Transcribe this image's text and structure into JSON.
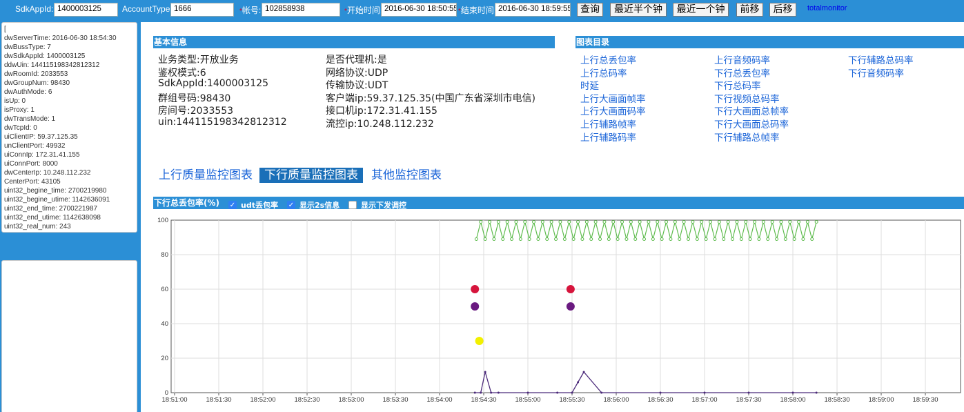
{
  "toolbar": {
    "sdkappid_label": "SdkAppId:",
    "sdkappid_value": "1400003125",
    "accounttype_label": "AccountType:",
    "accounttype_value": "1666",
    "account_label": "帐号:",
    "account_value": "102858938",
    "start_label": "开始时间:",
    "start_value": "2016-06-30 18:50:55",
    "end_label": "结束时间:",
    "end_value": "2016-06-30 18:59:55",
    "required_mark": "*",
    "query_btn": "查询",
    "half_btn": "最近半个钟",
    "one_btn": "最近一个钟",
    "prev_btn": "前移",
    "next_btn": "后移",
    "link": "totalmonitor"
  },
  "raw_lines": [
    "[",
    "dwServerTime: 2016-06-30 18:54:30",
    "dwBussType: 7",
    "dwSdkAppId: 1400003125",
    "ddwUin: 144115198342812312",
    "dwRoomId: 2033553",
    "dwGroupNum: 98430",
    "dwAuthMode: 6",
    "isUp: 0",
    "isProxy: 1",
    "dwTransMode: 1",
    "dwTcpId: 0",
    "uiClientIP: 59.37.125.35",
    "unClientPort: 49932",
    "uiConnIp: 172.31.41.155",
    "uiConnPort: 8000",
    "dwCenterIp: 10.248.112.232",
    "CenterPort: 43105",
    "uint32_begine_time: 2700219980",
    "uint32_begine_utime: 1142636091",
    "uint32_end_time: 2700221987",
    "uint32_end_utime: 1142638098",
    "uint32_real_num: 243"
  ],
  "basic_info": {
    "title": "基本信息",
    "col1": [
      "业务类型:开放业务",
      "鉴权模式:6",
      "SdkAppId:1400003125",
      "群组号码:98430",
      "房间号:2033553",
      "uin:144115198342812312"
    ],
    "col2": [
      "是否代理机:是",
      "网络协议:UDP",
      "传输协议:UDT",
      "客户端ip:59.37.125.35(中国广东省深圳市电信)",
      "接口机ip:172.31.41.155",
      "流控ip:10.248.112.232"
    ]
  },
  "catalog": {
    "title": "图表目录",
    "col1": [
      "上行总丢包率",
      "上行总码率",
      "时延",
      "上行大画面帧率",
      "上行大画面码率",
      "上行辅路帧率",
      "上行辅路码率"
    ],
    "col2": [
      "上行音频码率",
      "下行总丢包率",
      "下行总码率",
      "下行视频总码率",
      "下行大画面总帧率",
      "下行大画面总码率",
      "下行辅路总帧率"
    ],
    "col3": [
      "下行辅路总码率",
      "下行音频码率"
    ]
  },
  "tabs": [
    "上行质量监控图表",
    "下行质量监控图表",
    "其他监控图表"
  ],
  "chart_header": {
    "title": "下行总丢包率(%)",
    "opt1": "udt丢包率",
    "opt2": "显示2s信息",
    "opt3": "显示下发调控",
    "check": "✓"
  },
  "colors": {
    "header_blue": "#2b8fd6",
    "green_series": "#5dbb4c",
    "purple_series": "#4b2a7a",
    "red_marker": "#d6143c",
    "purple_marker": "#6a1a80",
    "yellow_marker": "#f2f000"
  },
  "chart_data": {
    "type": "line",
    "title": "下行总丢包率(%)",
    "ylim": [
      0,
      100
    ],
    "yticks": [
      0,
      20,
      40,
      60,
      80,
      100
    ],
    "x_start": "18:51:00",
    "x_end": "18:59:55",
    "xticks": [
      "18:51:00",
      "18:51:30",
      "18:52:00",
      "18:52:30",
      "18:53:00",
      "18:53:30",
      "18:54:00",
      "18:54:30",
      "18:55:00",
      "18:55:30",
      "18:56:00",
      "18:56:30",
      "18:57:00",
      "18:57:30",
      "18:58:00",
      "18:58:30",
      "18:59:00",
      "18:59:30"
    ],
    "grid": true,
    "series": [
      {
        "color": "#5dbb4c",
        "x": [
          "18:54:25",
          "18:54:28",
          "18:54:31",
          "18:54:34",
          "18:54:37",
          "18:54:40",
          "18:54:43",
          "18:54:46",
          "18:54:49",
          "18:54:52",
          "18:54:55",
          "18:54:58",
          "18:55:01",
          "18:55:04",
          "18:55:07",
          "18:55:10",
          "18:55:13",
          "18:55:16",
          "18:55:19",
          "18:55:22",
          "18:55:25",
          "18:55:28",
          "18:55:31",
          "18:55:34",
          "18:55:37",
          "18:55:40",
          "18:55:43",
          "18:55:46",
          "18:55:49",
          "18:55:52",
          "18:55:55",
          "18:55:58",
          "18:56:01",
          "18:56:04",
          "18:56:07",
          "18:56:10",
          "18:56:13",
          "18:56:16",
          "18:56:19",
          "18:56:22",
          "18:56:25",
          "18:56:28",
          "18:56:31",
          "18:56:34",
          "18:56:37",
          "18:56:40",
          "18:56:43",
          "18:56:46",
          "18:56:49",
          "18:56:52",
          "18:56:55",
          "18:56:58",
          "18:57:01",
          "18:57:04",
          "18:57:07",
          "18:57:10",
          "18:57:13",
          "18:57:16",
          "18:57:19",
          "18:57:22",
          "18:57:25",
          "18:57:28",
          "18:57:31",
          "18:57:34",
          "18:57:37",
          "18:57:40",
          "18:57:43",
          "18:57:46",
          "18:57:49",
          "18:57:52",
          "18:57:55",
          "18:57:58",
          "18:58:01",
          "18:58:04",
          "18:58:07",
          "18:58:10",
          "18:58:13",
          "18:58:16"
        ],
        "values": [
          89,
          99,
          89,
          99,
          89,
          99,
          89,
          99,
          89,
          99,
          89,
          99,
          89,
          99,
          89,
          99,
          89,
          99,
          89,
          99,
          89,
          99,
          89,
          99,
          89,
          99,
          89,
          99,
          89,
          99,
          89,
          99,
          89,
          99,
          89,
          99,
          89,
          99,
          89,
          99,
          89,
          99,
          89,
          99,
          89,
          99,
          89,
          99,
          89,
          99,
          89,
          99,
          89,
          99,
          89,
          99,
          89,
          99,
          89,
          99,
          89,
          99,
          89,
          99,
          89,
          99,
          89,
          99,
          89,
          99,
          89,
          99,
          89,
          99,
          89,
          99,
          89,
          99
        ]
      },
      {
        "color": "#4b2a7a",
        "x": [
          "18:54:24",
          "18:54:28",
          "18:54:31",
          "18:54:35",
          "18:54:40",
          "18:55:00",
          "18:55:20",
          "18:55:30",
          "18:55:34",
          "18:55:38",
          "18:55:50",
          "18:56:30",
          "18:57:00",
          "18:57:30",
          "18:58:00",
          "18:58:16"
        ],
        "values": [
          0,
          0,
          12,
          0,
          0,
          0,
          0,
          0,
          6,
          12,
          0,
          0,
          0,
          0,
          0,
          0
        ]
      }
    ],
    "markers": [
      {
        "x": "18:54:24",
        "y": 60,
        "color": "#d6143c"
      },
      {
        "x": "18:54:24",
        "y": 50,
        "color": "#6a1a80"
      },
      {
        "x": "18:54:27",
        "y": 30,
        "color": "#f2f000"
      },
      {
        "x": "18:55:29",
        "y": 60,
        "color": "#d6143c"
      },
      {
        "x": "18:55:29",
        "y": 50,
        "color": "#6a1a80"
      }
    ]
  }
}
